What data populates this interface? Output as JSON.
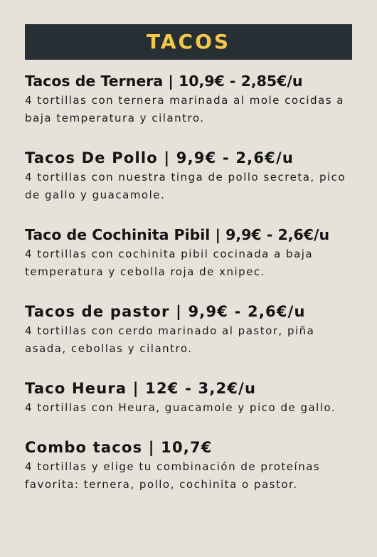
{
  "header": {
    "title": "TACOS"
  },
  "menu": {
    "items": [
      {
        "title": "Tacos de Ternera | 10,9€ - 2,85€/u",
        "description": "4 tortillas con ternera marinada al mole cocidas a baja temperatura y cilantro."
      },
      {
        "title": "Tacos De Pollo | 9,9€ - 2,6€/u",
        "description": "4 tortillas con nuestra tinga de pollo secreta, pico de gallo y guacamole."
      },
      {
        "title": "Taco de Cochinita Pibil | 9,9€ - 2,6€/u",
        "description": "4 tortillas con cochinita pibil cocinada a baja temperatura y cebolla roja de xnipec."
      },
      {
        "title": "Tacos de pastor | 9,9€ - 2,6€/u",
        "description": "4 tortillas con cerdo marinado al pastor, piña asada, cebollas y cilantro."
      },
      {
        "title": "Taco Heura | 12€ - 3,2€/u",
        "description": "4 tortillas con Heura, guacamole y pico de gallo."
      },
      {
        "title": "Combo tacos | 10,7€",
        "description": "4 tortillas y elige tu combinación de proteínas favorita: ternera, pollo, cochinita o pastor."
      }
    ]
  },
  "colors": {
    "background": "#e6e1d9",
    "header_background": "#263034",
    "header_text": "#f5c74a",
    "body_text": "#141414"
  }
}
